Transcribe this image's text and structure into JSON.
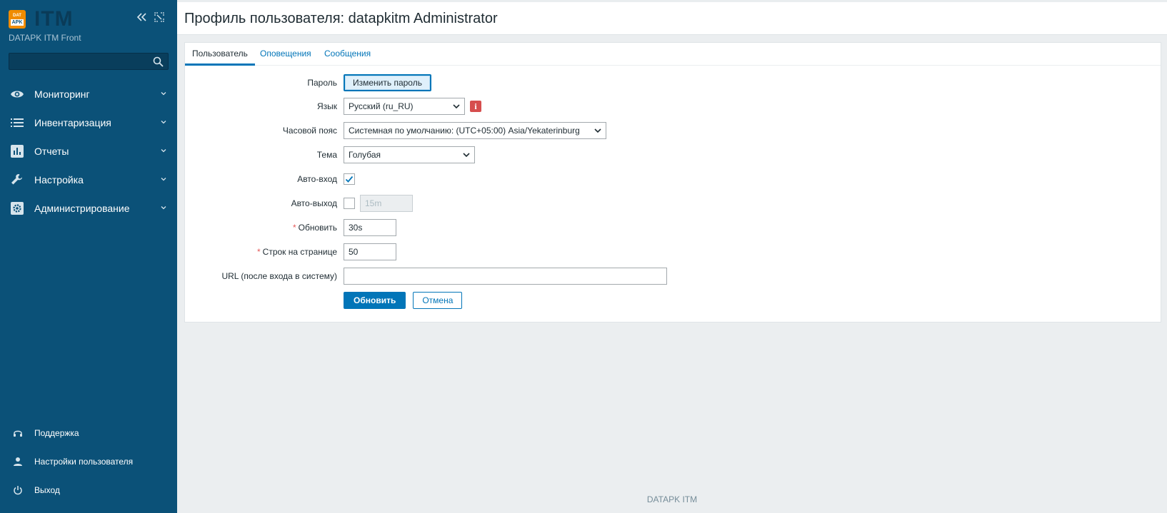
{
  "app": {
    "logo_top": "DAT",
    "logo_bottom": "APK",
    "logo_text": "ITM",
    "server_name": "DATAPK ITM Front"
  },
  "sidebar": {
    "search_value": "",
    "items": [
      {
        "label": "Мониторинг",
        "icon": "eye-icon"
      },
      {
        "label": "Инвентаризация",
        "icon": "list-icon"
      },
      {
        "label": "Отчеты",
        "icon": "bar-chart-icon"
      },
      {
        "label": "Настройка",
        "icon": "wrench-icon"
      },
      {
        "label": "Администрирование",
        "icon": "gear-icon"
      }
    ],
    "bottom": [
      {
        "label": "Поддержка",
        "icon": "headset-icon"
      },
      {
        "label": "Настройки пользователя",
        "icon": "user-icon"
      },
      {
        "label": "Выход",
        "icon": "power-icon"
      }
    ]
  },
  "header": {
    "title": "Профиль пользователя: datapkitm Administrator"
  },
  "tabs": [
    {
      "label": "Пользователь",
      "active": true
    },
    {
      "label": "Оповещения",
      "active": false
    },
    {
      "label": "Сообщения",
      "active": false
    }
  ],
  "form": {
    "password_label": "Пароль",
    "change_password_button": "Изменить пароль",
    "language_label": "Язык",
    "language_value": "Русский (ru_RU)",
    "language_info": "i",
    "timezone_label": "Часовой пояс",
    "timezone_value": "Системная по умолчанию: (UTC+05:00) Asia/Yekaterinburg",
    "theme_label": "Тема",
    "theme_value": "Голубая",
    "autologin_label": "Авто-вход",
    "autologin_checked": true,
    "autologout_label": "Авто-выход",
    "autologout_checked": false,
    "autologout_value": "15m",
    "refresh_required": "*",
    "refresh_label": "Обновить",
    "refresh_value": "30s",
    "rows_required": "*",
    "rows_label": "Строк на странице",
    "rows_value": "50",
    "url_label": "URL (после входа в систему)",
    "url_value": "",
    "update_button": "Обновить",
    "cancel_button": "Отмена"
  },
  "footer": {
    "text": "DATAPK ITM"
  },
  "colors": {
    "sidebar_bg": "#0b5178",
    "accent": "#0275b8",
    "logo": "#f08c00",
    "info": "#d64e4e"
  }
}
